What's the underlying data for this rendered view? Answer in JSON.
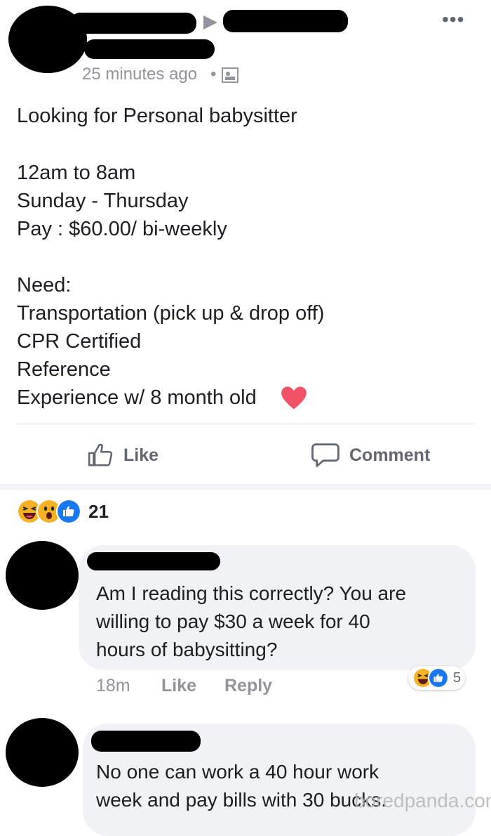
{
  "post": {
    "time": "25 minutes ago",
    "dot": "•",
    "more": "•••",
    "lines": [
      "Looking for Personal babysitter",
      "12am to 8am",
      "Sunday - Thursday",
      "Pay : $60.00/ bi-weekly",
      "Need:",
      "Transportation (pick up & drop off)",
      "CPR Certified",
      "Reference",
      "Experience w/ 8 month old"
    ],
    "like_label": "Like",
    "comment_label": "Comment"
  },
  "reactions": {
    "count": "21"
  },
  "comments": [
    {
      "lines": [
        "Am I reading this correctly? You are",
        "willing to pay $30 a week for 40",
        "hours of babysitting?"
      ],
      "time": "18m",
      "like_label": "Like",
      "reply_label": "Reply",
      "reaction_count": "5"
    },
    {
      "lines": [
        "No one can work a 40 hour work",
        "week and pay bills with 30 bucks."
      ]
    }
  ],
  "watermark": "boredpanda.com",
  "colors": {
    "like_blue": "#1877f2",
    "haha_yellow": "#f7b125",
    "heart_red": "#f25268",
    "meta_gray": "#90949c"
  }
}
